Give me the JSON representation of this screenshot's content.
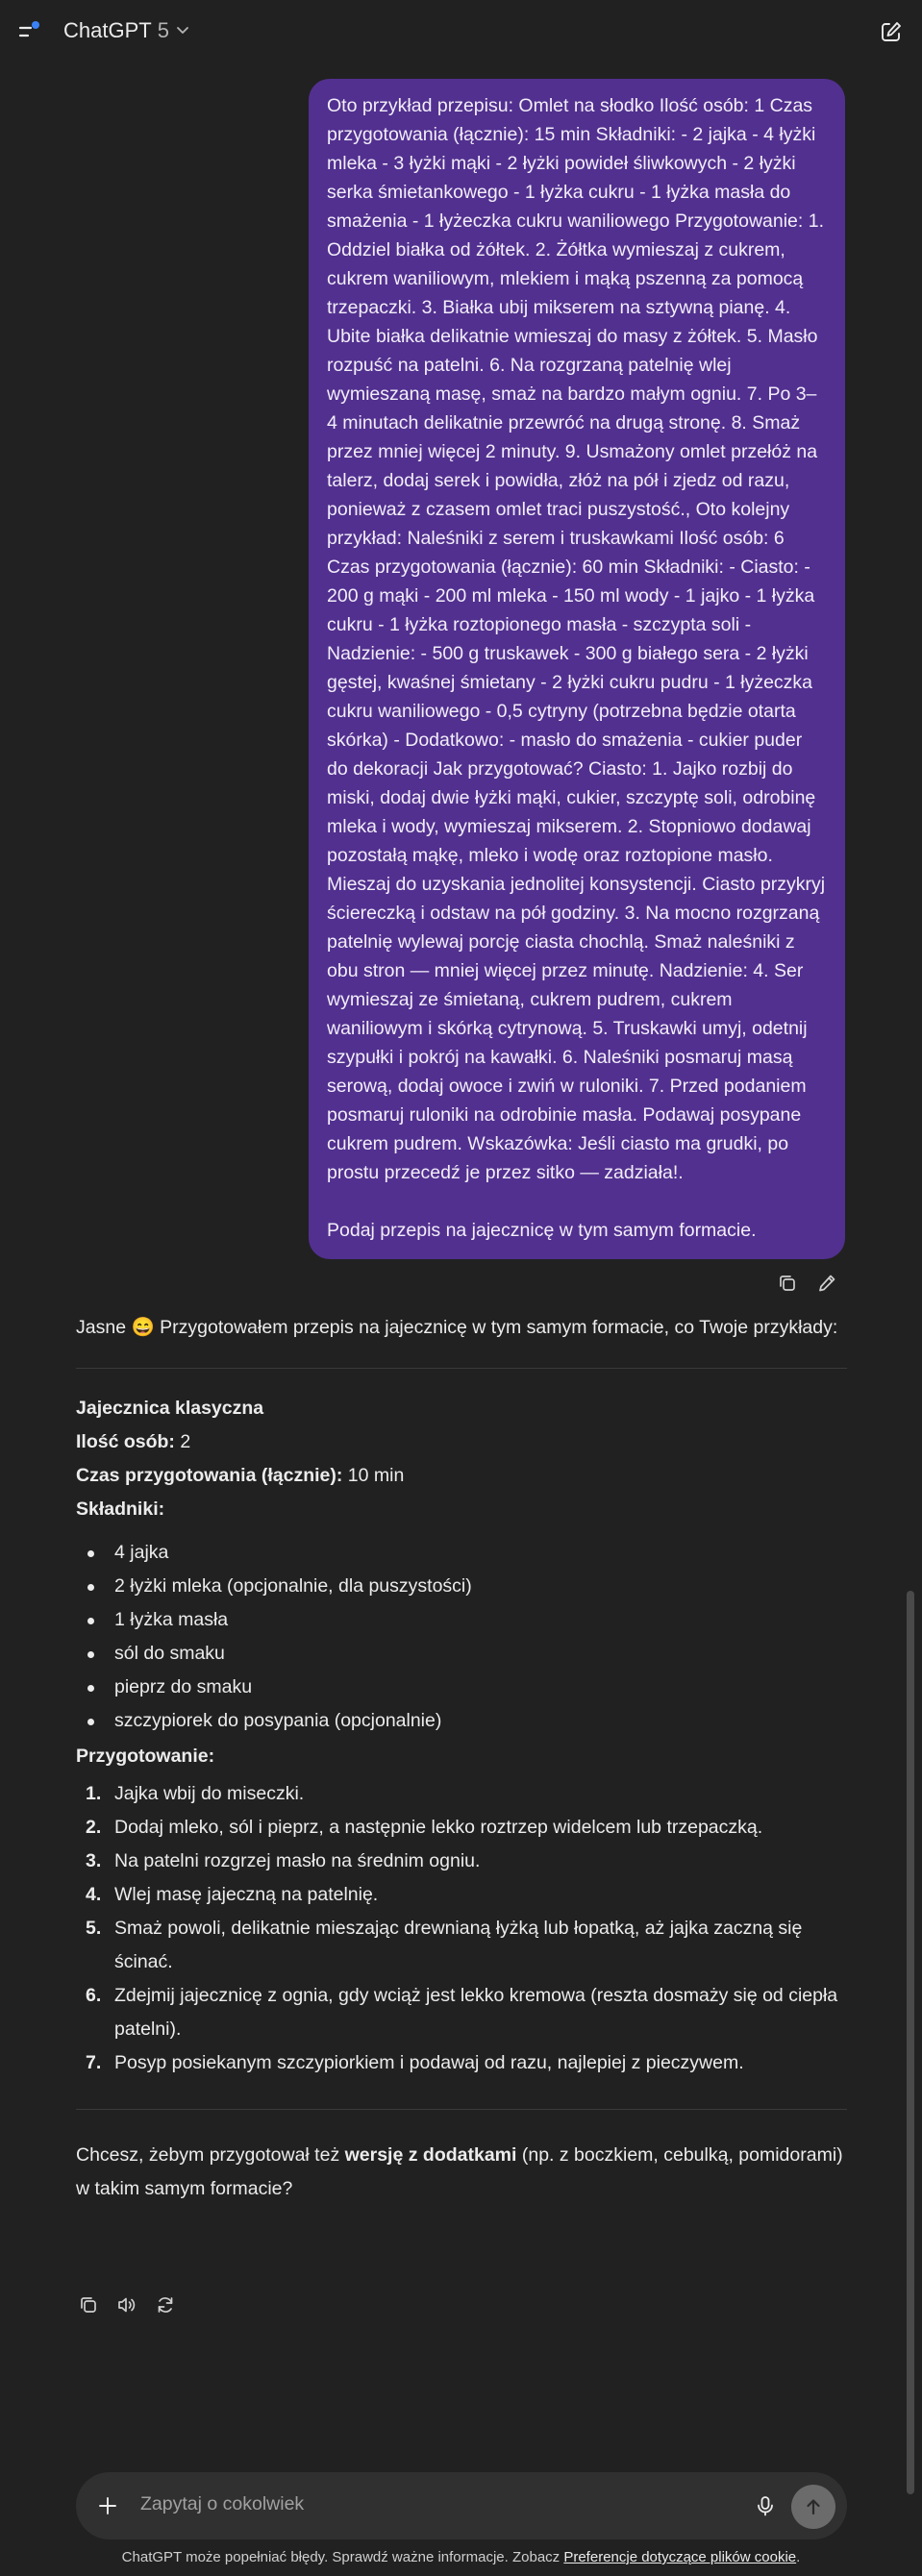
{
  "header": {
    "app_name": "ChatGPT",
    "model_version": "5",
    "icons": {
      "menu": "sidebar-menu-icon",
      "chevron": "chevron-down-icon",
      "new_chat": "new-chat-icon"
    },
    "accent_dot_color": "#3b82f6"
  },
  "user_message": {
    "text": "Oto przykład przepisu: Omlet na słodko Ilość osób: 1 Czas przygotowania (łącznie): 15 min Składniki: - 2 jajka - 4 łyżki mleka - 3 łyżki mąki - 2 łyżki powideł śliwkowych - 2 łyżki serka śmietankowego - 1 łyżka cukru - 1 łyżka masła do smażenia - 1 łyżeczka cukru waniliowego Przygotowanie: 1. Oddziel białka od żółtek. 2. Żółtka wymieszaj z cukrem, cukrem waniliowym, mlekiem i mąką pszenną za pomocą trzepaczki. 3. Białka ubij mikserem na sztywną pianę. 4. Ubite białka delikatnie wmieszaj do masy z żółtek. 5. Masło rozpuść na patelni. 6. Na rozgrzaną patelnię wlej wymieszaną masę, smaż na bardzo małym ogniu. 7. Po 3–4 minutach delikatnie przewróć na drugą stronę. 8. Smaż przez mniej więcej 2 minuty. 9. Usmażony omlet przełóż na talerz, dodaj serek i powidła, złóż na pół i zjedz od razu, ponieważ z czasem omlet traci puszystość., Oto kolejny przykład: Naleśniki z serem i truskawkami Ilość osób: 6 Czas przygotowania (łącznie): 60 min Składniki: - Ciasto: - 200 g mąki - 200 ml mleka - 150 ml wody - 1 jajko - 1 łyżka cukru - 1 łyżka roztopionego masła - szczypta soli - Nadzienie: - 500 g truskawek - 300 g białego sera - 2 łyżki gęstej, kwaśnej śmietany - 2 łyżki cukru pudru - 1 łyżeczka cukru waniliowego - 0,5 cytryny (potrzebna będzie otarta skórka) - Dodatkowo: - masło do smażenia - cukier puder do dekoracji Jak przygotować? Ciasto: 1. Jajko rozbij do miski, dodaj dwie łyżki mąki, cukier, szczyptę soli, odrobinę mleka i wody, wymieszaj mikserem. 2. Stopniowo dodawaj pozostałą mąkę, mleko i wodę oraz roztopione masło. Mieszaj do uzyskania jednolitej konsystencji. Ciasto przykryj ściereczką i odstaw na pół godziny. 3. Na mocno rozgrzaną patelnię wylewaj porcję ciasta chochlą. Smaż naleśniki z obu stron — mniej więcej przez minutę. Nadzienie: 4. Ser wymieszaj ze śmietaną, cukrem pudrem, cukrem waniliowym i skórką cytrynową. 5. Truskawki umyj, odetnij szypułki i pokrój na kawałki. 6. Naleśniki posmaruj masą serową, dodaj owoce i zwiń w ruloniki. 7. Przed podaniem posmaruj ruloniki na odrobinie masła. Podawaj posypane cukrem pudrem. Wskazówka: Jeśli ciasto ma grudki, po prostu przecedź je przez sitko — zadziała!.",
    "follow_up": "Podaj przepis na jajecznicę w tym samym formacie.",
    "bubble_color": "#52308f",
    "action_icons": [
      "copy-icon",
      "edit-icon"
    ]
  },
  "assistant": {
    "intro": "Jasne 😄 Przygotowałem przepis na jajecznicę w tym samym formacie, co Twoje przykłady:",
    "recipe": {
      "title": "Jajecznica klasyczna",
      "servings_label": "Ilość osób:",
      "servings_value": " 2",
      "time_label": "Czas przygotowania (łącznie):",
      "time_value": " 10 min",
      "ingredients_heading": "Składniki:",
      "ingredients": [
        "4 jajka",
        "2 łyżki mleka (opcjonalnie, dla puszystości)",
        "1 łyżka masła",
        "sól do smaku",
        "pieprz do smaku",
        "szczypiorek do posypania (opcjonalnie)"
      ],
      "steps_heading": "Przygotowanie:",
      "steps": [
        {
          "num": "1.",
          "text": "Jajka wbij do miseczki."
        },
        {
          "num": "2.",
          "text": "Dodaj mleko, sól i pieprz, a następnie lekko roztrzep widelcem lub trzepaczką."
        },
        {
          "num": "3.",
          "text": "Na patelni rozgrzej masło na średnim ogniu."
        },
        {
          "num": "4.",
          "text": "Wlej masę jajeczną na patelnię."
        },
        {
          "num": "5.",
          "text": "Smaż powoli, delikatnie mieszając drewnianą łyżką lub łopatką, aż jajka zaczną się ścinać."
        },
        {
          "num": "6.",
          "text": "Zdejmij jajecznicę z ognia, gdy wciąż jest lekko kremowa (reszta dosmaży się od ciepła patelni)."
        },
        {
          "num": "7.",
          "text": "Posyp posiekanym szczypiorkiem i podawaj od razu, najlepiej z pieczywem."
        }
      ]
    },
    "closing_pre": "Chcesz, żebym przygotował też ",
    "closing_bold": "wersję z dodatkami",
    "closing_post": " (np. z boczkiem, cebulką, pomidorami) w takim samym formacie?",
    "action_icons": [
      "copy-icon",
      "read-aloud-icon",
      "regenerate-icon"
    ]
  },
  "composer": {
    "placeholder": "Zapytaj o cokolwiek",
    "icons": [
      "plus-icon",
      "microphone-icon",
      "send-arrow-icon"
    ]
  },
  "footer": {
    "disclaimer": "ChatGPT może popełniać błędy. Sprawdź ważne informacje. Zobacz ",
    "link": "Preferencje dotyczące plików cookie",
    "end": "."
  }
}
